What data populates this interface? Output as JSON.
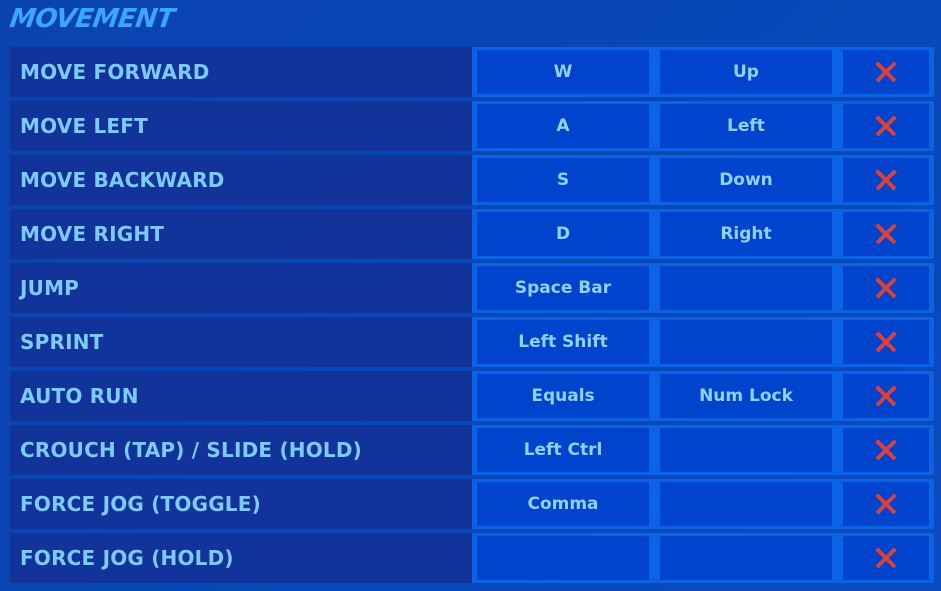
{
  "section": {
    "title": "MOVEMENT"
  },
  "colors": {
    "accent": "#3aa6ff",
    "label_text": "#7ccaff",
    "clear_icon": "#d8413c"
  },
  "bindings": [
    {
      "action": "MOVE FORWARD",
      "primary": "W",
      "secondary": "Up",
      "clear_icon": "close-icon"
    },
    {
      "action": "MOVE LEFT",
      "primary": "A",
      "secondary": "Left",
      "clear_icon": "close-icon"
    },
    {
      "action": "MOVE BACKWARD",
      "primary": "S",
      "secondary": "Down",
      "clear_icon": "close-icon"
    },
    {
      "action": "MOVE RIGHT",
      "primary": "D",
      "secondary": "Right",
      "clear_icon": "close-icon"
    },
    {
      "action": "JUMP",
      "primary": "Space Bar",
      "secondary": "",
      "clear_icon": "close-icon"
    },
    {
      "action": "SPRINT",
      "primary": "Left Shift",
      "secondary": "",
      "clear_icon": "close-icon"
    },
    {
      "action": "AUTO RUN",
      "primary": "Equals",
      "secondary": "Num Lock",
      "clear_icon": "close-icon"
    },
    {
      "action": "CROUCH (TAP) / SLIDE (HOLD)",
      "primary": "Left Ctrl",
      "secondary": "",
      "clear_icon": "close-icon"
    },
    {
      "action": "FORCE JOG (TOGGLE)",
      "primary": "Comma",
      "secondary": "",
      "clear_icon": "close-icon"
    },
    {
      "action": "FORCE JOG (HOLD)",
      "primary": "",
      "secondary": "",
      "clear_icon": "close-icon"
    }
  ]
}
